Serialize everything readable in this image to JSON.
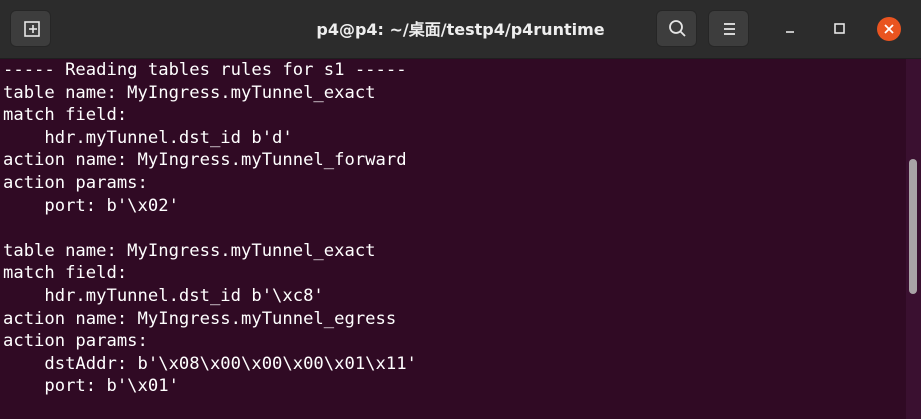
{
  "window": {
    "title": "p4@p4: ~/桌面/testp4/p4runtime",
    "background": "#300a24",
    "titlebar_background": "#2c2c2c",
    "close_button_color": "#e95420"
  },
  "titlebar": {
    "new_tab_icon": "new-tab-icon",
    "search_icon": "search-icon",
    "menu_icon": "hamburger-menu-icon",
    "minimize_icon": "minimize-icon",
    "maximize_icon": "maximize-icon",
    "close_icon": "close-icon"
  },
  "terminal": {
    "lines": [
      "----- Reading tables rules for s1 -----",
      "table name: MyIngress.myTunnel_exact",
      "match field:",
      "    hdr.myTunnel.dst_id b'd'",
      "action name: MyIngress.myTunnel_forward",
      "action params:",
      "    port: b'\\x02'",
      "",
      "table name: MyIngress.myTunnel_exact",
      "match field:",
      "    hdr.myTunnel.dst_id b'\\xc8'",
      "action name: MyIngress.myTunnel_egress",
      "action params:",
      "    dstAddr: b'\\x08\\x00\\x00\\x00\\x01\\x11'",
      "    port: b'\\x01'"
    ]
  }
}
